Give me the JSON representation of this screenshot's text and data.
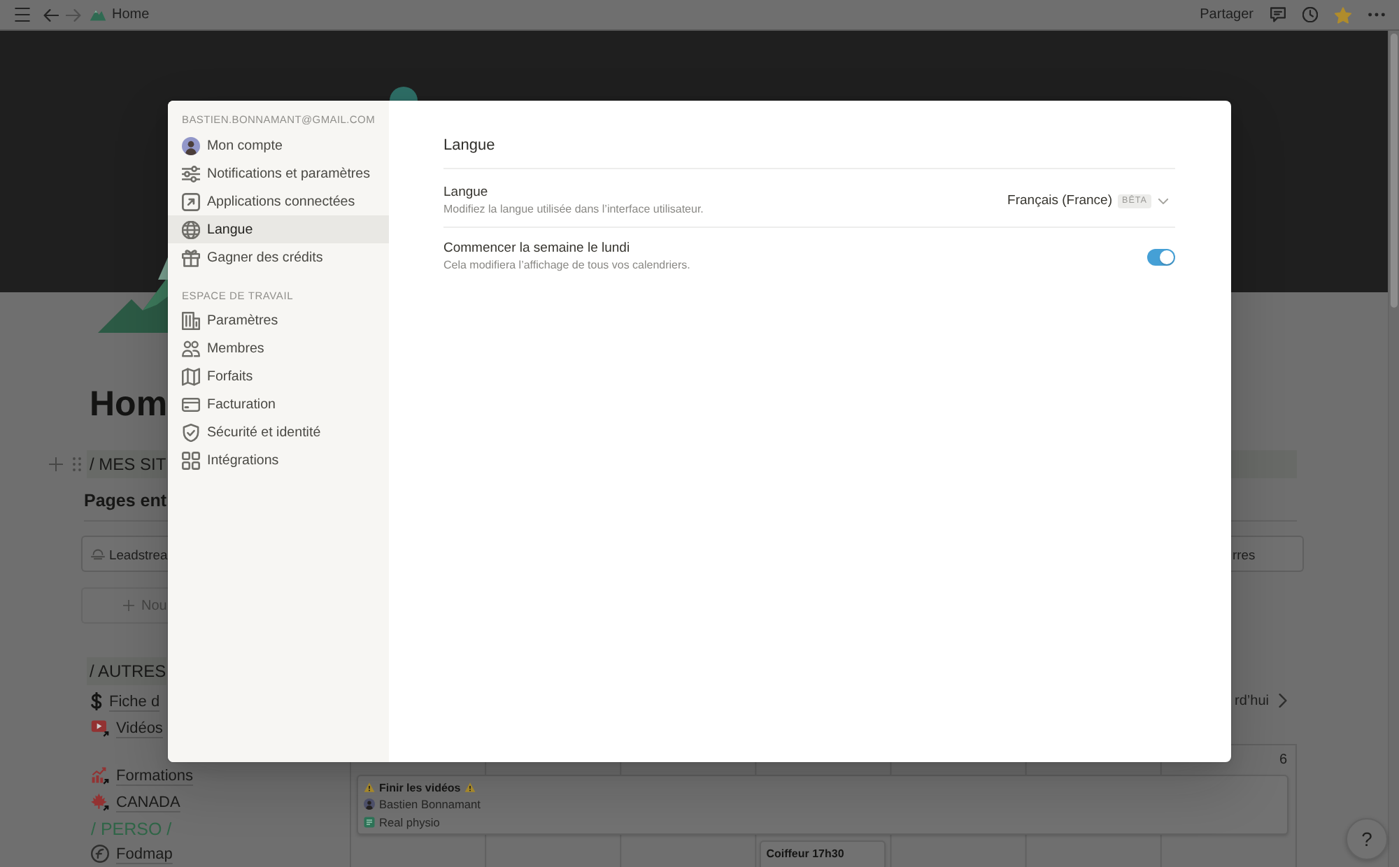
{
  "top_bar": {
    "breadcrumb": "Home",
    "share": "Partager",
    "favorited": true
  },
  "page": {
    "title": "Hom",
    "heading_1": "/ MES SIT",
    "subheading": "Pages ent",
    "cards": [
      {
        "label": "Leadstrea"
      },
      {
        "label": "rres"
      }
    ],
    "new_button": "Nou",
    "heading_2": "/ AUTRES",
    "links": [
      {
        "label": "Fiche d"
      },
      {
        "label": "Vidéos"
      },
      {
        "label": "Formations"
      },
      {
        "label": "CANADA"
      }
    ],
    "heading_3": "/ PERSO /",
    "perso_links": [
      {
        "label": "Fodmap"
      }
    ],
    "calendar": {
      "today_button": "rd’hui",
      "day_number": "6",
      "events": [
        {
          "title": "Finir les vidéos",
          "warning": true,
          "person": "Bastien Bonnamant",
          "relation": "Real physio"
        },
        {
          "title": "Coiffeur 17h30"
        }
      ]
    }
  },
  "help_button": "?",
  "settings_modal": {
    "account_email": "BASTIEN.BONNAMANT@GMAIL.COM",
    "account_items": [
      {
        "label": "Mon compte",
        "selected": false
      },
      {
        "label": "Notifications et paramètres",
        "selected": false
      },
      {
        "label": "Applications connectées",
        "selected": false
      },
      {
        "label": "Langue",
        "selected": true
      },
      {
        "label": "Gagner des crédits",
        "selected": false
      }
    ],
    "workspace_header": "ESPACE DE TRAVAIL",
    "workspace_items": [
      {
        "label": "Paramètres",
        "selected": false
      },
      {
        "label": "Membres",
        "selected": false
      },
      {
        "label": "Forfaits",
        "selected": false
      },
      {
        "label": "Facturation",
        "selected": false
      },
      {
        "label": "Sécurité et identité",
        "selected": false
      },
      {
        "label": "Intégrations",
        "selected": false
      }
    ],
    "panel_title": "Langue",
    "settings": [
      {
        "kind": "select",
        "label": "Langue",
        "description": "Modifiez la langue utilisée dans l’interface utilisateur.",
        "value": "Français (France)",
        "badge": "BÊTA"
      },
      {
        "kind": "toggle",
        "label": "Commencer la semaine le lundi",
        "description": "Cela modifiera l’affichage de tous vos calendriers.",
        "on": true
      }
    ]
  }
}
